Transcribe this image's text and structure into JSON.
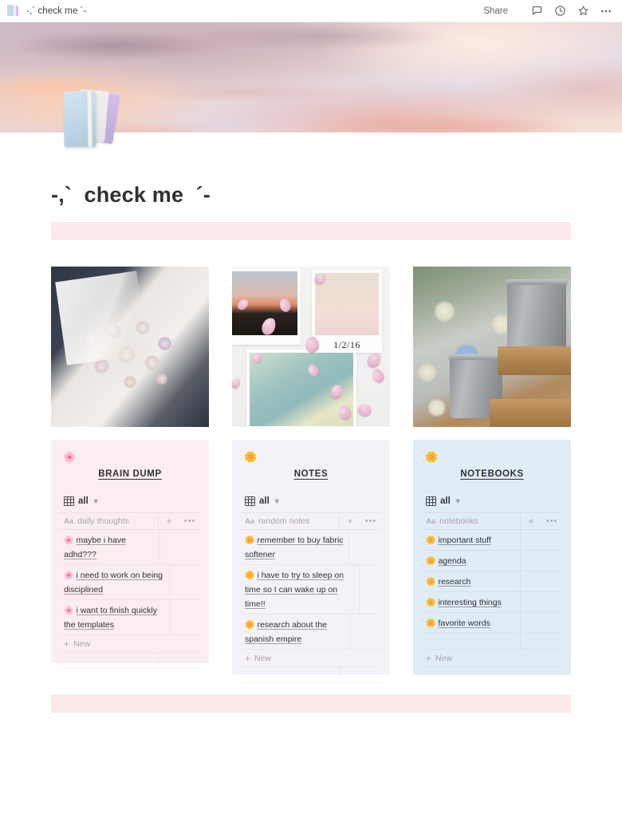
{
  "browser": {
    "tab_title": "-,` check me ´-",
    "favicon_icon": "notebooks-icon",
    "share_label": "Share",
    "icons": [
      "comment-icon",
      "history-clock-icon",
      "star-icon",
      "more-options-icon"
    ]
  },
  "page": {
    "cover_image": "pastel-sunset-sky-banner",
    "icon": "stack-of-notebooks-icon",
    "title": "-,`  check me  ´-"
  },
  "divider_blocks": {
    "top_callout_color": "#fceaea",
    "bottom_callout_color": "#fceaea"
  },
  "gallery": [
    {
      "name": "bouquet-of-pastel-roses-in-car",
      "alt": "white wrapped bouquet of pastel roses"
    },
    {
      "name": "polaroid-photos-with-petals",
      "alt": "polaroid photos with scattered pink petals",
      "handwritten_date": "1/2/16"
    },
    {
      "name": "hydrangeas-in-metal-buckets",
      "alt": "blue and white hydrangeas in galvanized buckets"
    }
  ],
  "databases": [
    {
      "id": "brain-dump",
      "emoji": "🌸",
      "title": "BRAIN DUMP",
      "view_label": "all",
      "view_icon": "table-grid-icon",
      "column_header": "daily thoughts",
      "column_type_icon": "Aa",
      "add_label": "+",
      "more_label": "•••",
      "new_label": "New",
      "blank_rows": 1,
      "rows": [
        {
          "emoji": "🌸",
          "text": "maybe i have adhd???"
        },
        {
          "emoji": "🌸",
          "text": "i need to work on being disciplined"
        },
        {
          "emoji": "🌸",
          "text": "i want to finish quickly the templates"
        }
      ]
    },
    {
      "id": "notes",
      "emoji": "🌼",
      "title": "NOTES",
      "view_label": "all",
      "view_icon": "table-grid-icon",
      "column_header": "random notes",
      "column_type_icon": "Aa",
      "add_label": "+",
      "more_label": "•••",
      "new_label": "New",
      "blank_rows": 1,
      "rows": [
        {
          "emoji": "🌼",
          "text": "remember to buy fabric softener"
        },
        {
          "emoji": "🌼",
          "text": "i have to try to sleep on time so I can wake up on time!!"
        },
        {
          "emoji": "🌼",
          "text": "research about the spanish empire"
        }
      ]
    },
    {
      "id": "notebooks",
      "emoji": "🌼",
      "title": "NOTEBOOKS",
      "view_label": "all",
      "view_icon": "table-grid-icon",
      "column_header": "notebooks",
      "column_type_icon": "Aa",
      "add_label": "+",
      "more_label": "•••",
      "new_label": "New",
      "blank_rows": 2,
      "rows": [
        {
          "emoji": "🌼",
          "text": "important stuff"
        },
        {
          "emoji": "🌼",
          "text": "agenda"
        },
        {
          "emoji": "🌼",
          "text": "research"
        },
        {
          "emoji": "🌼",
          "text": "interesting things"
        },
        {
          "emoji": "🌼",
          "text": "favorite words"
        }
      ]
    }
  ]
}
